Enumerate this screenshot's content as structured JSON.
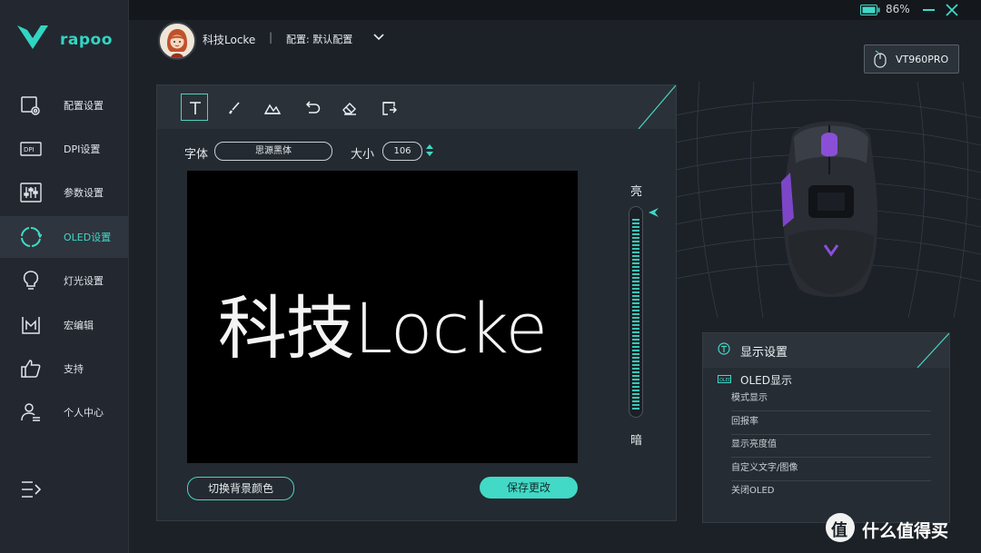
{
  "window": {
    "battery_percent": "86%"
  },
  "brand": {
    "name": "rapoo"
  },
  "sidebar": {
    "items": [
      {
        "label": "配置设置",
        "icon": "config-icon"
      },
      {
        "label": "DPI设置",
        "icon": "dpi-icon"
      },
      {
        "label": "参数设置",
        "icon": "params-icon"
      },
      {
        "label": "OLED设置",
        "icon": "oled-icon",
        "active": true
      },
      {
        "label": "灯光设置",
        "icon": "bulb-icon"
      },
      {
        "label": "宏编辑",
        "icon": "macro-icon"
      },
      {
        "label": "支持",
        "icon": "thumbs-up-icon"
      },
      {
        "label": "个人中心",
        "icon": "user-icon"
      }
    ]
  },
  "header": {
    "username": "科技Locke",
    "separator": "|",
    "config": "配置: 默认配置"
  },
  "device": {
    "label": "VT960PRO"
  },
  "editor": {
    "font_label": "字体",
    "font_value": "思源黑体",
    "size_label": "大小",
    "size_value": "106",
    "canvas_text": "科技Locke",
    "bright_label": "亮",
    "dark_label": "暗",
    "brightness_fraction": 0.97,
    "switch_bg_label": "切换背景颜色",
    "save_label": "保存更改"
  },
  "settings": {
    "title": "显示设置",
    "oled_label": "OLED显示",
    "items": [
      "模式显示",
      "回报率",
      "显示亮度值",
      "自定义文字/图像",
      "关闭OLED"
    ]
  },
  "watermark": {
    "text": "什么值得买",
    "logo_char": "值"
  },
  "colors": {
    "accent": "#42d9c7",
    "background": "#1c2128",
    "sidebar": "#232830"
  }
}
